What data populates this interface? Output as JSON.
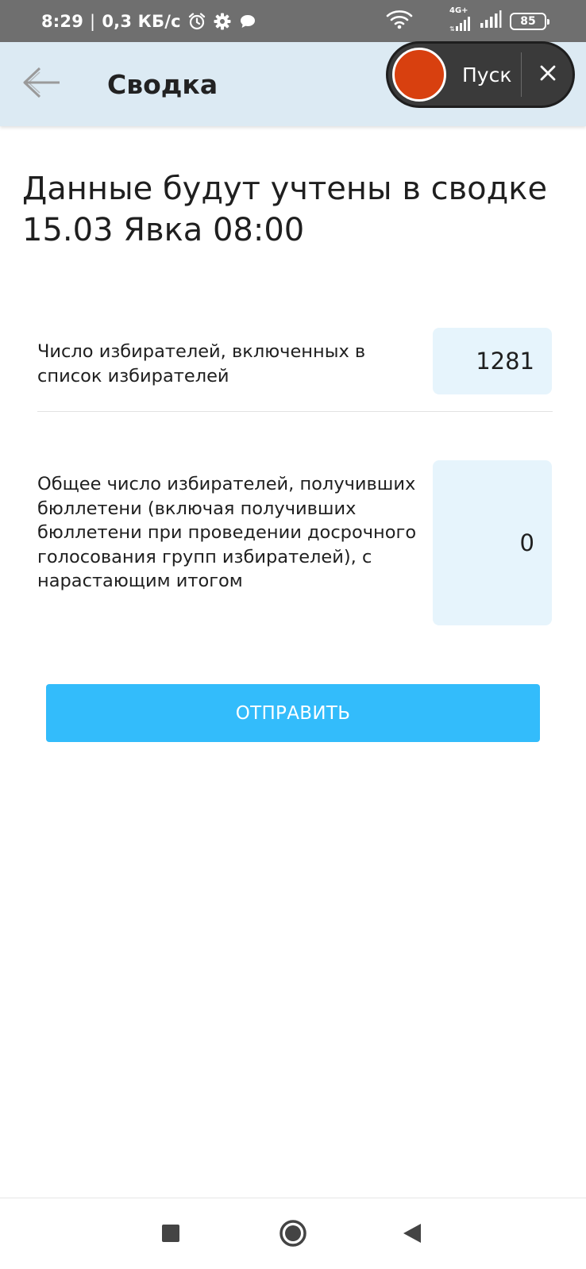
{
  "status_bar": {
    "time": "8:29",
    "separator": "|",
    "speed": "0,3 КБ/с",
    "network": "4G+",
    "battery": "85"
  },
  "app_bar": {
    "title": "Сводка"
  },
  "recorder": {
    "start_label": "Пуск",
    "record_color": "#d8400f"
  },
  "content": {
    "heading_line1": "Данные будут учтены в сводке",
    "heading_line2": "15.03 Явка 08:00",
    "fields": [
      {
        "label": "Число избирателей, включенных в список избирателей",
        "value": "1281"
      },
      {
        "label": "Общее число избирателей, получивших бюллетени (включая получивших бюллетени при проведении досрочного голосования групп избирателей), с нарастающим итогом",
        "value": "0"
      }
    ],
    "submit_label": "ОТПРАВИТЬ"
  },
  "colors": {
    "app_bar_bg": "#dceaf3",
    "input_bg": "#e6f4fc",
    "button_bg": "#33bcfb",
    "status_bar_bg": "#6f6f6f"
  },
  "icons": {
    "alarm": "alarm-icon",
    "settings": "gear-icon",
    "message": "message-icon",
    "wifi": "wifi-icon",
    "signal": "signal-icon",
    "battery": "battery-icon",
    "back": "back-arrow-icon",
    "close": "close-icon",
    "nav_recent": "square-icon",
    "nav_home": "circle-icon",
    "nav_back": "triangle-icon"
  }
}
